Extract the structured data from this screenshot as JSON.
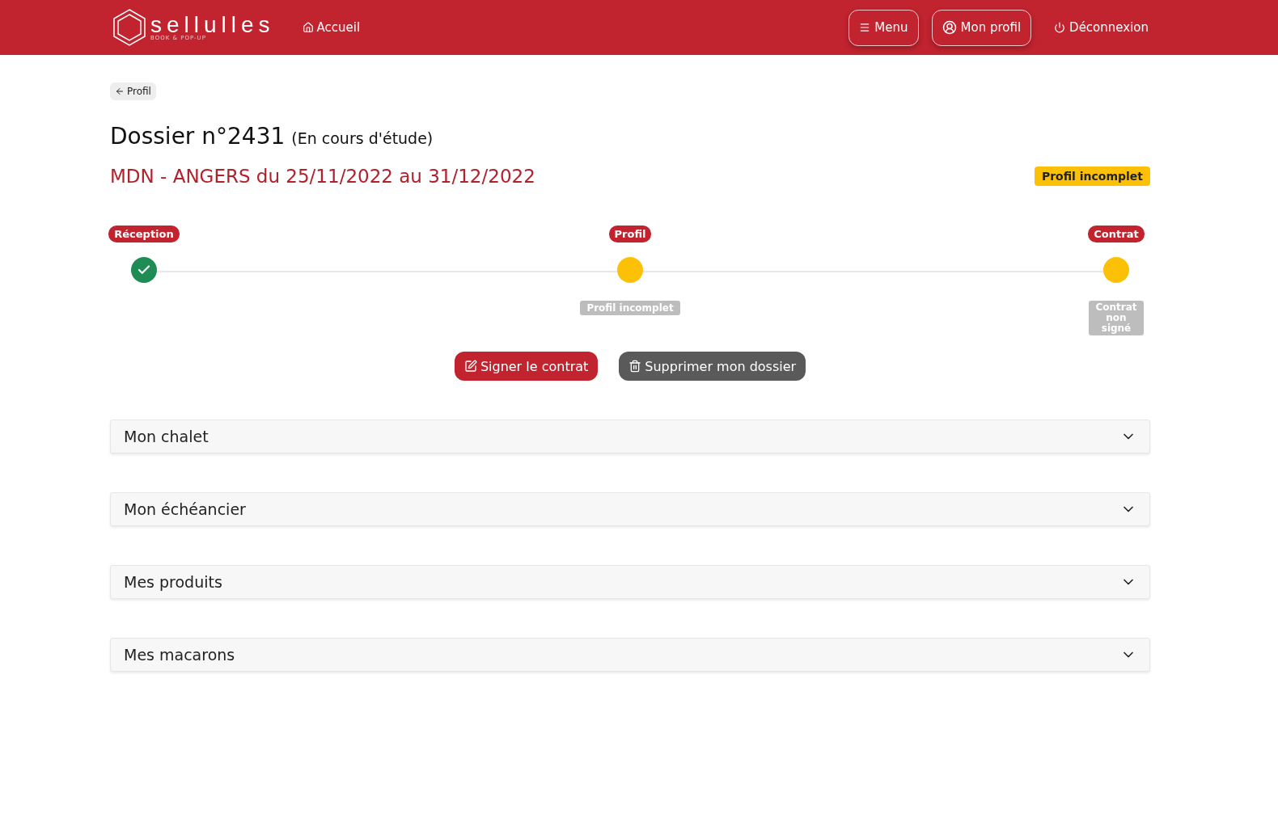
{
  "brand": {
    "name": "sellulles",
    "tagline": "BOOK & POP-UP"
  },
  "nav": {
    "home": "Accueil",
    "buttons": [
      {
        "label": "Menu",
        "kind": "menu",
        "outlined": true
      },
      {
        "label": "Mon profil",
        "kind": "profile",
        "outlined": true
      },
      {
        "label": "Déconnexion",
        "kind": "logout",
        "outlined": false
      }
    ]
  },
  "back_link": "Profil",
  "title": {
    "main": "Dossier n°2431",
    "status": "(En cours d'étude)"
  },
  "event": "MDN - ANGERS du 25/11/2022 au 31/12/2022",
  "status_badge": "Profil incomplet",
  "steps": [
    {
      "label": "Réception",
      "kind": "done"
    },
    {
      "label": "Profil",
      "kind": "pending",
      "note": "Profil incomplet"
    },
    {
      "label": "Contrat",
      "kind": "pending",
      "note": "Contrat non signé"
    }
  ],
  "actions": [
    {
      "label": "Signer le contrat",
      "kind": "sign"
    },
    {
      "label": "Supprimer mon dossier",
      "kind": "delete"
    }
  ],
  "sections": [
    {
      "title": "Mon chalet",
      "expanded": false
    },
    {
      "title": "Mon échéancier",
      "expanded": false
    },
    {
      "title": "Mes produits",
      "expanded": false
    },
    {
      "title": "Mes macarons",
      "expanded": false
    }
  ]
}
